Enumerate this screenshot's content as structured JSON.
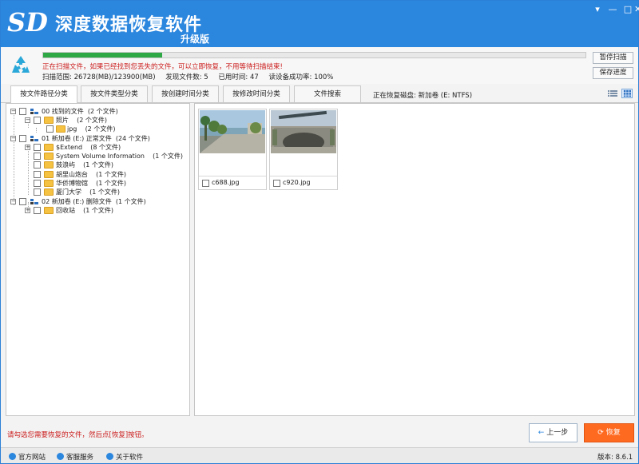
{
  "app": {
    "title": "深度数据恢复软件",
    "edition": "升级版",
    "brand_color": "#2b86de"
  },
  "window_controls": [
    "menu",
    "minimize",
    "maximize",
    "close"
  ],
  "scan": {
    "progress_fraction": 0.22,
    "warning": "正在扫描文件，如果已经找到您丢失的文件，可以立即恢复，不用等待扫描结束!",
    "range_text": "扫描范围: 26728(MB)/123900(MB)",
    "found_text": "发现文件数: 5",
    "elapsed_text": "已用时间: 47",
    "read_rate_text": "读设备成功率: 100%",
    "pause_label": "暂停扫描",
    "save_label": "保存进度"
  },
  "tabs": [
    {
      "label": "按文件路径分类",
      "active": true
    },
    {
      "label": "按文件类型分类",
      "active": false
    },
    {
      "label": "按创建时间分类",
      "active": false
    },
    {
      "label": "按修改时间分类",
      "active": false
    },
    {
      "label": "文件搜索",
      "active": false
    }
  ],
  "disk_label": "正在恢复磁盘: 新加卷 (E: NTFS)",
  "tree": [
    {
      "label": "00 找到的文件",
      "count": "(2 个文件)"
    },
    {
      "label": "照片",
      "count": "(2 个文件)"
    },
    {
      "label": "jpg",
      "count": "(2 个文件)"
    },
    {
      "label": "01 新加卷 (E:) 正常文件",
      "count": "(24 个文件)"
    },
    {
      "label": "$Extend",
      "count": "(8 个文件)"
    },
    {
      "label": "System Volume Information",
      "count": "(1 个文件)"
    },
    {
      "label": "鼓浪屿",
      "count": "(1 个文件)"
    },
    {
      "label": "胡里山炮台",
      "count": "(1 个文件)"
    },
    {
      "label": "华侨博物馆",
      "count": "(1 个文件)"
    },
    {
      "label": "厦门大学",
      "count": "(1 个文件)"
    },
    {
      "label": "02 新加卷 (E:) 删除文件",
      "count": "(1 个文件)"
    },
    {
      "label": "回收站",
      "count": "(1 个文件)"
    }
  ],
  "files": [
    {
      "name": "c688.jpg"
    },
    {
      "name": "c920.jpg"
    }
  ],
  "hint": "请勾选您需要恢复的文件，然后点[恢复]按钮。",
  "buttons": {
    "prev": "上一步",
    "recover": "恢复"
  },
  "status_bar": {
    "official_site": "官方网站",
    "support": "客服服务",
    "about": "关于软件",
    "version": "版本: 8.6.1"
  }
}
